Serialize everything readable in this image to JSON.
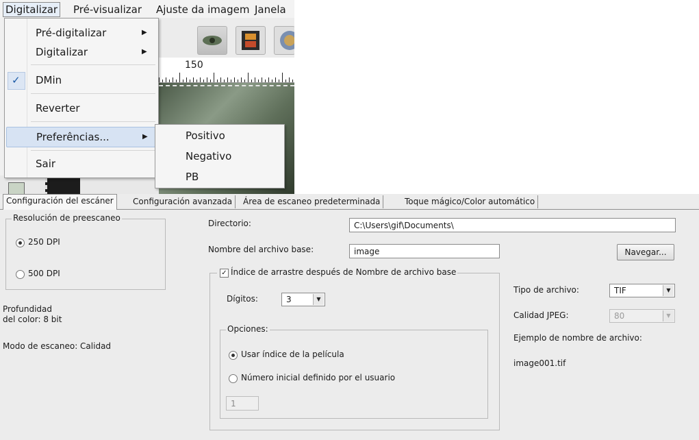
{
  "menubar": {
    "items": [
      "Digitalizar",
      "Pré-visualizar",
      "Ajuste da imagem",
      "Janela"
    ],
    "active_index": 0
  },
  "menu": {
    "items": [
      {
        "label": "Pré-digitalizar",
        "submenu": true
      },
      {
        "label": "Digitalizar",
        "submenu": true
      },
      {
        "label": "DMin",
        "checked": true
      },
      {
        "label": "Reverter"
      },
      {
        "label": "Preferências...",
        "submenu": true,
        "highlighted": true
      },
      {
        "label": "Sair"
      }
    ],
    "submenu_items": [
      "Positivo",
      "Negativo",
      "PB"
    ]
  },
  "ruler": {
    "label": "150"
  },
  "icons": {
    "submenu_arrow": "▶",
    "check": "✓",
    "dropdown_arrow": "▼"
  },
  "dialog": {
    "tabs": [
      "Configuración del escáner",
      "Configuración avanzada",
      "Área de escaneo predeterminada",
      "Toque mágico/Color automático"
    ],
    "active_tab": 0,
    "preview_resolution": {
      "title": "Resolución de preescaneo",
      "options": [
        "250 DPI",
        "500 DPI"
      ],
      "selected": 0
    },
    "color_depth": {
      "line1": "Profundidad",
      "line2": "del color:  8 bit"
    },
    "scan_mode": "Modo de escaneo: Calidad",
    "directory": {
      "label": "Directorio:",
      "value": "C:\\Users\\gif\\Documents\\"
    },
    "base_name": {
      "label": "Nombre del archivo base:",
      "value": "image"
    },
    "browse_button": "Navegar...",
    "index_group": {
      "title": "Índice de arrastre después de Nombre de archivo base",
      "checked": true,
      "digits_label": "Dígitos:",
      "digits_value": "3",
      "options": {
        "title": "Opciones:",
        "choices": [
          "Usar índice de la película",
          "Número inicial definido por el usuario"
        ],
        "selected": 0,
        "start_value": "1"
      }
    },
    "file_type": {
      "label": "Tipo de archivo:",
      "value": "TIF"
    },
    "jpeg_quality": {
      "label": "Calidad JPEG:",
      "value": "80"
    },
    "example": {
      "label": "Ejemplo de nombre de archivo:",
      "value": "image001.tif"
    }
  }
}
